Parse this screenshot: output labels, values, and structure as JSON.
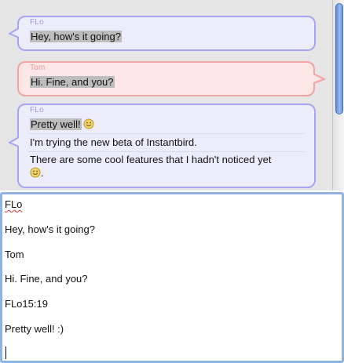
{
  "conversation": {
    "messages": [
      {
        "sender": "FLo",
        "direction": "incoming",
        "lines": [
          "Hey, how's it going?"
        ]
      },
      {
        "sender": "Tom",
        "direction": "outgoing",
        "lines": [
          "Hi. Fine, and you?"
        ]
      },
      {
        "sender": "FLo",
        "direction": "incoming",
        "lines": [
          "Pretty well!",
          "I'm trying the new beta of Instantbird.",
          "There are some cool features that I hadn't noticed yet",
          "."
        ]
      }
    ],
    "scroll_position": 0.0
  },
  "input": {
    "lines": [
      "FLo",
      "Hey, how's it going?",
      "Tom",
      "Hi. Fine, and you?",
      "FLo15:19",
      "Pretty well! :)"
    ]
  },
  "colors": {
    "incoming_border": "#a6a6f2",
    "incoming_bg": "#ececfb",
    "outgoing_border": "#f0a4a4",
    "outgoing_bg": "#fce6e6",
    "input_focus": "#8fb2e0"
  },
  "icons": {
    "smiley": "smiley-emoticon-icon"
  }
}
